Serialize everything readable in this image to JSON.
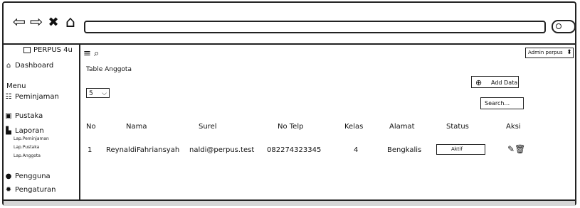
{
  "browser": {
    "back_icon": "⇦",
    "forward_icon": "⇨",
    "close_icon": "✖",
    "home_icon": "⌂"
  },
  "sidebar": {
    "brand": "PERPUS 4u",
    "items": [
      {
        "label": "Dashboard",
        "icon": "⌂"
      },
      {
        "label": "Menu"
      },
      {
        "label": "Peminjaman",
        "icon": "☷"
      },
      {
        "label": "Pustaka",
        "icon": "▣"
      },
      {
        "label": "Laporan",
        "icon": "▙"
      },
      {
        "label": "Pengguna",
        "icon": "●"
      },
      {
        "label": "Pengaturan",
        "icon": "✹"
      }
    ],
    "subitems": [
      "Lap.Peminjaman",
      "Lap.Pustaka",
      "Lap.Anggota"
    ]
  },
  "header": {
    "menu_icon": "≡",
    "search_icon": "⌕",
    "admin_label": "Admin perpus"
  },
  "main": {
    "title": "Table Anggota",
    "add_label": "Add Data",
    "page_size": "5",
    "search_placeholder": "Search...",
    "columns": [
      "No",
      "Nama",
      "Surel",
      "No Telp",
      "Kelas",
      "Alamat",
      "Status",
      "Aksi"
    ],
    "rows": [
      {
        "no": "1",
        "nama": "ReynaldiFahriansyah",
        "surel": "naldi@perpus.test",
        "telp": "082274323345",
        "kelas": "4",
        "alamat": "Bengkalis",
        "status": "Aktif"
      }
    ]
  }
}
